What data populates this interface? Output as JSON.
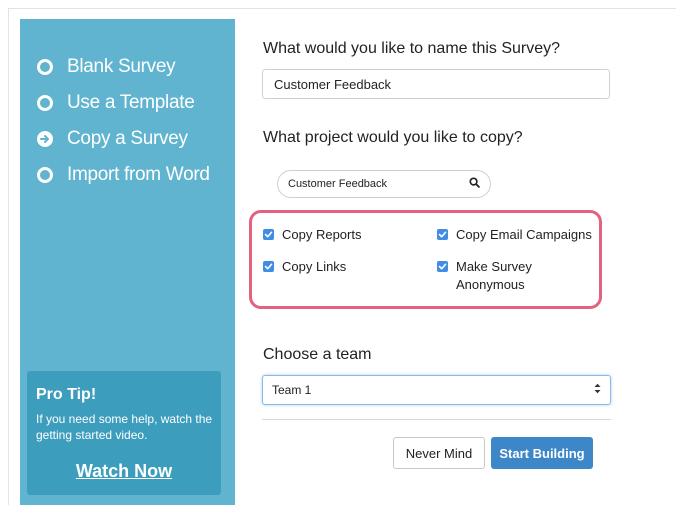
{
  "sidebar": {
    "options": [
      {
        "label": "Blank Survey",
        "icon": "radio-empty-icon"
      },
      {
        "label": "Use a Template",
        "icon": "radio-empty-icon"
      },
      {
        "label": "Copy a Survey",
        "icon": "arrow-circle-right-icon",
        "selected": true
      },
      {
        "label": "Import from Word",
        "icon": "radio-empty-icon"
      }
    ],
    "protip": {
      "title": "Pro Tip!",
      "body": "If you need some help, watch the getting started video.",
      "link": "Watch Now"
    }
  },
  "main": {
    "name_label": "What would you like to name this Survey?",
    "name_value": "Customer Feedback",
    "project_label": "What project would you like to copy?",
    "project_search_value": "Customer Feedback",
    "options": {
      "copy_reports": {
        "label": "Copy Reports",
        "checked": true
      },
      "copy_email_campaigns": {
        "label": "Copy Email Campaigns",
        "checked": true
      },
      "copy_links": {
        "label": "Copy Links",
        "checked": true
      },
      "make_anonymous": {
        "label": "Make Survey Anonymous",
        "checked": true
      }
    },
    "team_label": "Choose a team",
    "team_value": "Team 1",
    "cancel_label": "Never Mind",
    "submit_label": "Start Building"
  },
  "colors": {
    "sidebar_bg": "#60b4d0",
    "protip_bg": "#3d9dbd",
    "highlight": "#e3627d",
    "checkbox": "#3f8ee3",
    "primary_button": "#3d87c9"
  }
}
